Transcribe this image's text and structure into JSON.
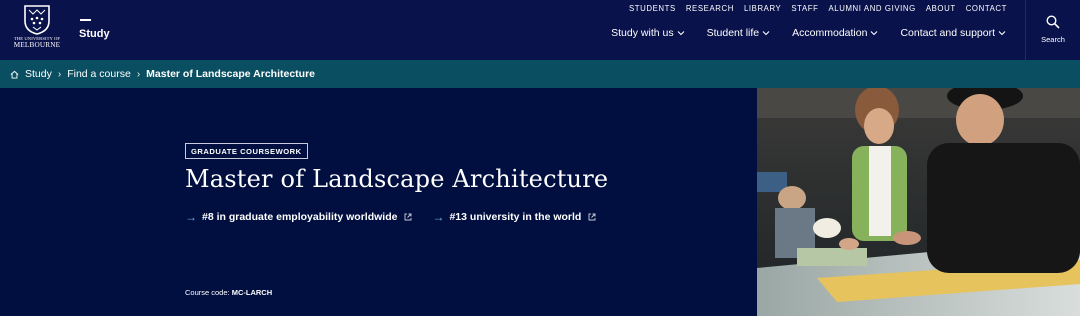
{
  "logo": {
    "line1": "THE UNIVERSITY OF",
    "line2": "MELBOURNE"
  },
  "header": {
    "section_title": "Study",
    "utility_nav": [
      "STUDENTS",
      "RESEARCH",
      "LIBRARY",
      "STAFF",
      "ALUMNI AND GIVING",
      "ABOUT",
      "CONTACT"
    ],
    "main_nav": [
      "Study with us",
      "Student life",
      "Accommodation",
      "Contact and support"
    ],
    "search_label": "Search"
  },
  "breadcrumb": [
    "Study",
    "Find a course",
    "Master of Landscape Architecture"
  ],
  "hero": {
    "tag": "GRADUATE COURSEWORK",
    "title": "Master of Landscape Architecture",
    "rankings": [
      "#8 in graduate employability worldwide",
      "#13 university in the world"
    ],
    "course_code_label": "Course code:",
    "course_code": "MC-LARCH"
  },
  "colors": {
    "header_bg": "#09124a",
    "breadcrumb_bg": "#0a4e61",
    "hero_bg": "#000f3f",
    "accent_arrow": "#6fb3e8"
  }
}
